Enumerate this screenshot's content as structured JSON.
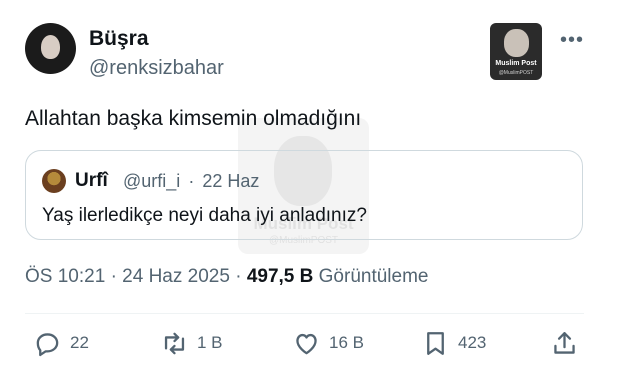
{
  "tweet": {
    "author_name": "Büşra",
    "author_handle": "@renksizbahar",
    "text": "Allahtan başka kimsemin olmadığını",
    "time": "ÖS 10:21",
    "date": "24 Haz 2025",
    "views_count": "497,5 B",
    "views_label": "Görüntüleme"
  },
  "watermark": {
    "title": "Muslim Post",
    "handle": "@MuslimPOST"
  },
  "quote": {
    "author_name": "Urfî",
    "author_handle": "@urfi_i",
    "age": "22 Haz",
    "text": "Yaş ilerledikçe neyi daha iyi anladınız?"
  },
  "actions": {
    "replies": "22",
    "reposts": "1 B",
    "likes": "16 B",
    "bookmarks": "423"
  },
  "icons": {
    "more": "more-dots-icon",
    "reply": "reply-icon",
    "repost": "repost-icon",
    "like": "heart-icon",
    "bookmark": "bookmark-icon",
    "share": "share-icon"
  },
  "colors": {
    "text": "#0f1419",
    "secondary": "#536471",
    "border": "#cfd9de"
  }
}
